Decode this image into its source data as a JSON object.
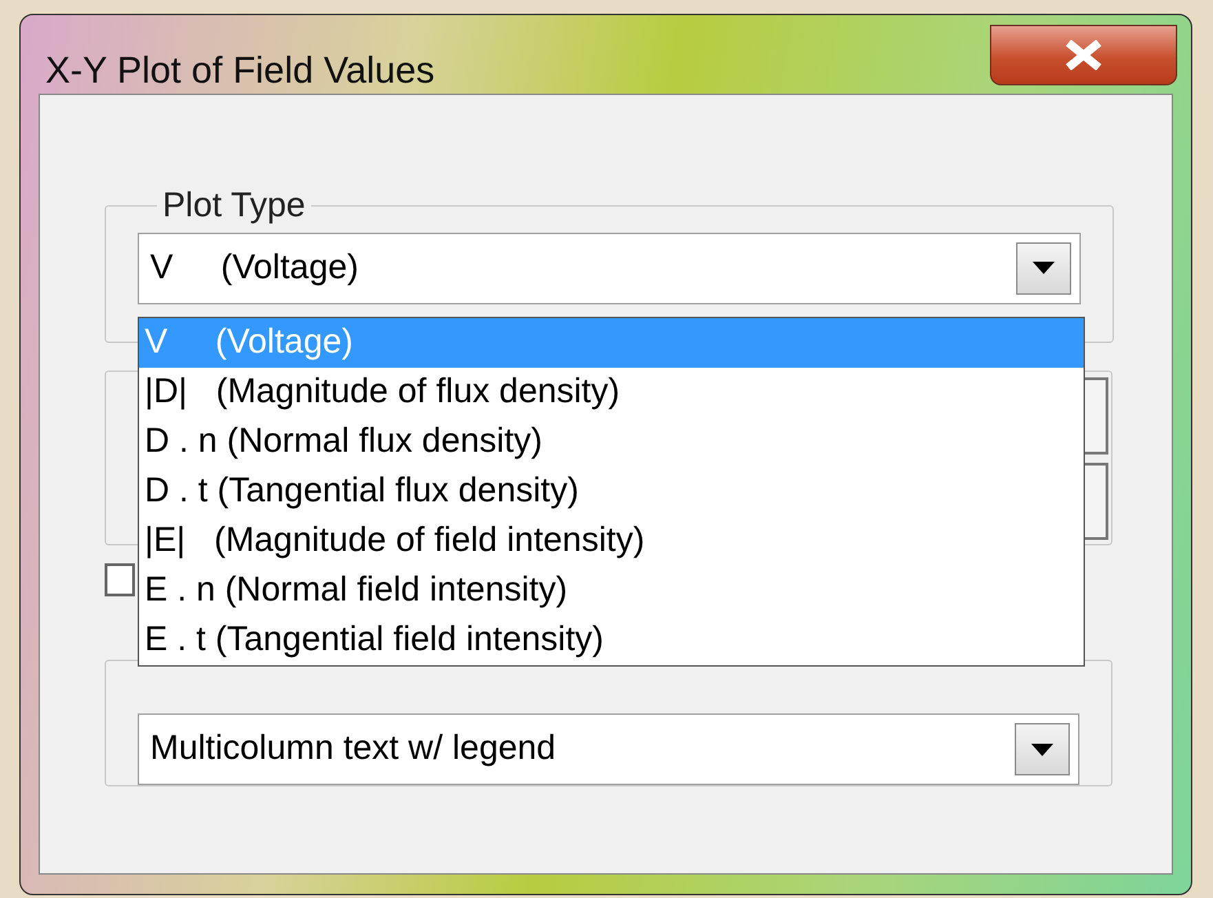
{
  "window": {
    "title": "X-Y Plot of Field Values"
  },
  "plot_type": {
    "label": "Plot Type",
    "value": "V     (Voltage)",
    "expanded": true,
    "options": [
      {
        "label": "V     (Voltage)",
        "selected": true
      },
      {
        "label": "|D|   (Magnitude of flux density)",
        "selected": false
      },
      {
        "label": "D . n (Normal flux density)",
        "selected": false
      },
      {
        "label": "D . t (Tangential flux density)",
        "selected": false
      },
      {
        "label": "|E|   (Magnitude of field intensity)",
        "selected": false
      },
      {
        "label": "E . n (Normal field intensity)",
        "selected": false
      },
      {
        "label": "E . t (Tangential field intensity)",
        "selected": false
      }
    ]
  },
  "option_checkbox": {
    "checked": false
  },
  "file_formatting": {
    "value": "Multicolumn text w/ legend"
  }
}
